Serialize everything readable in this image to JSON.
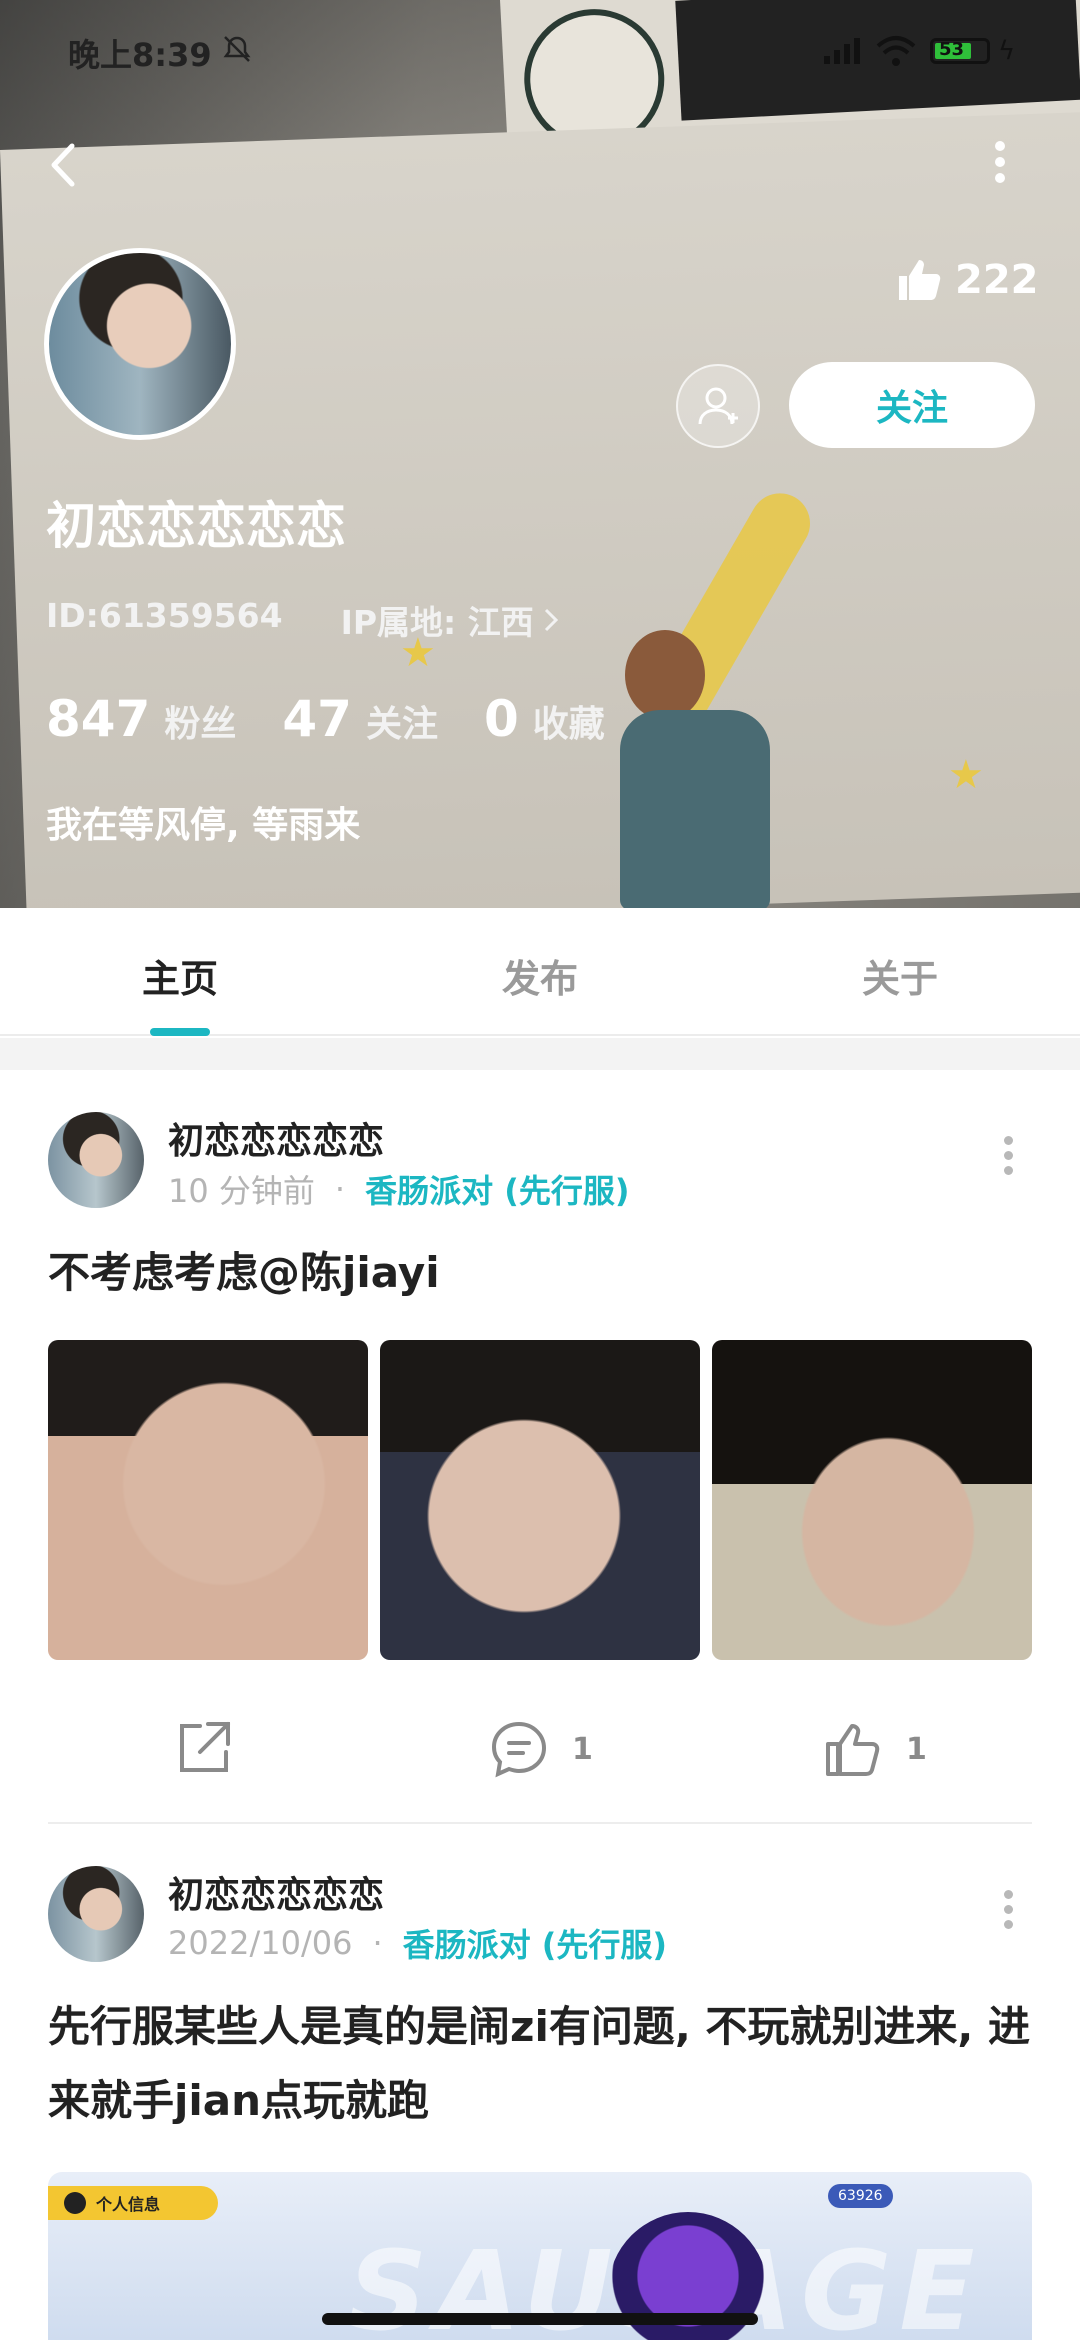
{
  "status_bar": {
    "time": "晚上8:39",
    "battery": "53"
  },
  "profile": {
    "likes": "222",
    "follow_label": "关注",
    "username": "初恋恋恋恋恋",
    "id_text": "ID:61359564",
    "ip_text": "IP属地: 江西",
    "stats": [
      {
        "num": "847",
        "label": "粉丝"
      },
      {
        "num": "47",
        "label": "关注"
      },
      {
        "num": "0",
        "label": "收藏"
      }
    ],
    "bio": "我在等风停, 等雨来"
  },
  "tabs": [
    {
      "label": "主页",
      "active": true
    },
    {
      "label": "发布",
      "active": false
    },
    {
      "label": "关于",
      "active": false
    }
  ],
  "posts": [
    {
      "author": "初恋恋恋恋恋",
      "time": "10 分钟前",
      "game": "香肠派对 (先行服)",
      "text": "不考虑考虑@陈jiayi",
      "comments": "1",
      "likes": "1"
    },
    {
      "author": "初恋恋恋恋恋",
      "time": "2022/10/06",
      "game": "香肠派对 (先行服)",
      "text": "先行服某些人是真的是闹zi有问题, 不玩就别进来, 进来就手jian点玩就跑",
      "banner_tag": "个人信息",
      "banner_coin": "63926"
    }
  ],
  "colors": {
    "accent": "#1cb7c2",
    "text_primary": "#222222",
    "text_secondary": "#b4b4b4"
  }
}
